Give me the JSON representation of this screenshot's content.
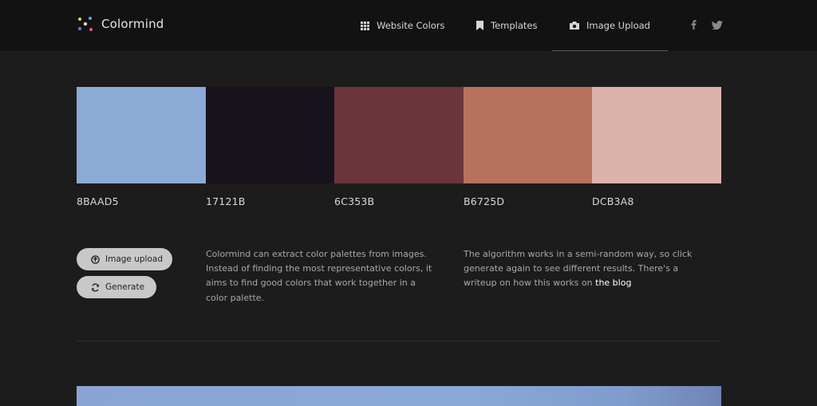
{
  "brand": {
    "name": "Colormind"
  },
  "nav": {
    "items": [
      {
        "label": "Website Colors",
        "icon": "grid-icon"
      },
      {
        "label": "Templates",
        "icon": "bookmark-icon"
      },
      {
        "label": "Image Upload",
        "icon": "camera-icon",
        "active": true
      }
    ],
    "social": [
      "facebook-icon",
      "twitter-icon"
    ]
  },
  "palette": [
    {
      "hex": "8BAAD5",
      "color": "#8BAAD5"
    },
    {
      "hex": "17121B",
      "color": "#17121B"
    },
    {
      "hex": "6C353B",
      "color": "#6C353B"
    },
    {
      "hex": "B6725D",
      "color": "#B6725D"
    },
    {
      "hex": "DCB3A8",
      "color": "#DCB3A8"
    }
  ],
  "buttons": {
    "upload": {
      "label": "Image upload",
      "icon": "upload-icon"
    },
    "generate": {
      "label": "Generate",
      "icon": "refresh-icon"
    }
  },
  "description": {
    "left": "Colormind can extract color palettes from images. Instead of finding the most representative colors, it aims to find good colors that work together in a color palette.",
    "right_text": "The algorithm works in a semi-random way, so click generate again to see different results. There's a writeup on how this works on",
    "right_link": "the blog"
  },
  "colors": {
    "background": "#1c1c1c",
    "nav_background": "#121212",
    "button": "#c8c8c8"
  }
}
